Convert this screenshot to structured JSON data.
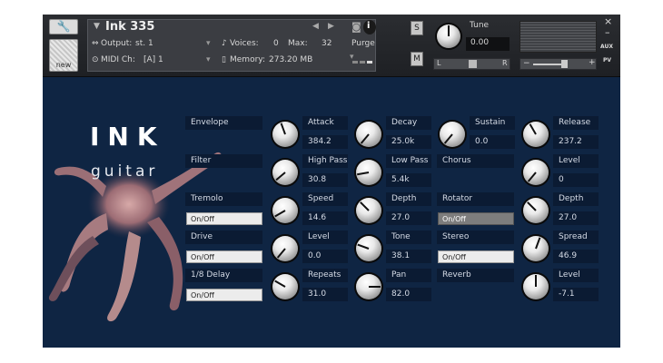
{
  "header": {
    "wrench_glyph": "🔧",
    "new_label": "new",
    "instrument": {
      "name": "Ink 335",
      "output_label": "Output:",
      "output_value": "st. 1",
      "voices_label": "Voices:",
      "voices_value": "0",
      "max_label": "Max:",
      "max_value": "32",
      "purge_label": "Purge",
      "midi_label": "MIDI Ch:",
      "midi_value": "[A] 1",
      "memory_label": "Memory:",
      "memory_value": "273.20 MB"
    },
    "s_label": "S",
    "m_label": "M",
    "tune_label": "Tune",
    "tune_value": "0.00",
    "pan_left": "L",
    "pan_right": "R",
    "vol_minus": "−",
    "vol_plus": "+",
    "aux_label": "AUX",
    "pv_label": "PV",
    "close_glyph": "×",
    "minimize_glyph": "–"
  },
  "brand": {
    "title": "INK",
    "subtitle": "guitar"
  },
  "sections": {
    "envelope": "Envelope",
    "filter": "Filter",
    "tremolo": "Tremolo",
    "drive": "Drive",
    "delay": "1/8 Delay",
    "chorus": "Chorus",
    "rotator": "Rotator",
    "stereo": "Stereo",
    "reverb": "Reverb"
  },
  "toggles": {
    "tremolo": "On/Off",
    "drive": "On/Off",
    "delay": "On/Off",
    "rotator": "On/Off",
    "stereo": "On/Off"
  },
  "params": {
    "attack": {
      "label": "Attack",
      "value": "384.2"
    },
    "decay": {
      "label": "Decay",
      "value": "25.0k"
    },
    "sustain": {
      "label": "Sustain",
      "value": "0.0"
    },
    "release": {
      "label": "Release",
      "value": "237.2"
    },
    "high_pass": {
      "label": "High Pass",
      "value": "30.8"
    },
    "low_pass": {
      "label": "Low Pass",
      "value": "5.4k"
    },
    "chorus_level": {
      "label": "Level",
      "value": "0"
    },
    "trem_speed": {
      "label": "Speed",
      "value": "14.6"
    },
    "trem_depth": {
      "label": "Depth",
      "value": "27.0"
    },
    "rot_depth": {
      "label": "Depth",
      "value": "27.0"
    },
    "drive_level": {
      "label": "Level",
      "value": "0.0"
    },
    "drive_tone": {
      "label": "Tone",
      "value": "38.1"
    },
    "stereo_spread": {
      "label": "Spread",
      "value": "46.9"
    },
    "delay_repeats": {
      "label": "Repeats",
      "value": "31.0"
    },
    "delay_pan": {
      "label": "Pan",
      "value": "82.0"
    },
    "reverb_level": {
      "label": "Level",
      "value": "-7.1"
    }
  }
}
